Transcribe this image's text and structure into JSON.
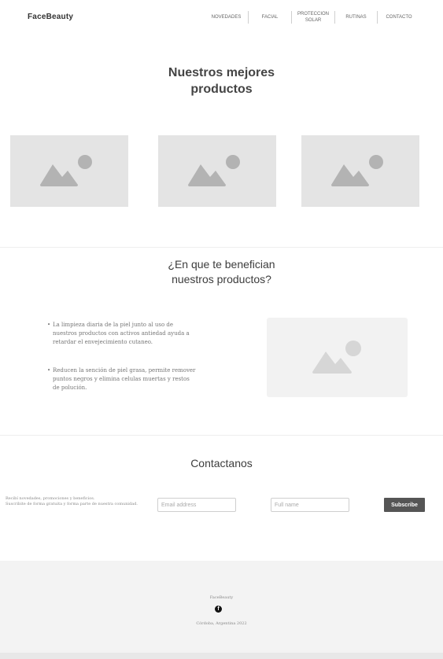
{
  "header": {
    "brand": "FaceBeauty",
    "nav": [
      {
        "label": "NOVEDADES"
      },
      {
        "label": "FACIAL"
      },
      {
        "label_line1": "PROTECCION",
        "label_line2": "SOLAR"
      },
      {
        "label": "RUTINAS"
      },
      {
        "label": "CONTACTO"
      }
    ]
  },
  "products": {
    "title_line1": "Nuestros mejores",
    "title_line2": "productos",
    "images": [
      "image-placeholder-icon",
      "image-placeholder-icon",
      "image-placeholder-icon"
    ]
  },
  "benefits": {
    "title_line1": "¿En que te benefician",
    "title_line2": "nuestros productos?",
    "items": [
      "La limpieza diaria de la piel junto al uso de nuestros productos con activos antiedad ayuda a retardar el envejecimiento cutaneo.",
      "Reducen la sención de piel grasa, permite remover puntos negros y elimina celulas muertas y restos de polución."
    ],
    "bullet": "•"
  },
  "contact": {
    "title": "Contactanos",
    "text_line1": "Recibí novedades, promociones y beneficios.",
    "text_line2": "Suscribite de forma gratuita y forma parte de nuestra comunidad.",
    "email_placeholder": "Email address",
    "name_placeholder": "Full name",
    "subscribe_label": "Subscribe"
  },
  "footer": {
    "brand": "FaceBeauty",
    "social_icon": "facebook-icon",
    "location": "Córdoba, Argentina 2022"
  },
  "colors": {
    "placeholder_bg": "#e4e4e4",
    "placeholder_icon": "#b3b3b3",
    "button_bg": "#555555",
    "footer_bg": "#f3f3f3"
  }
}
